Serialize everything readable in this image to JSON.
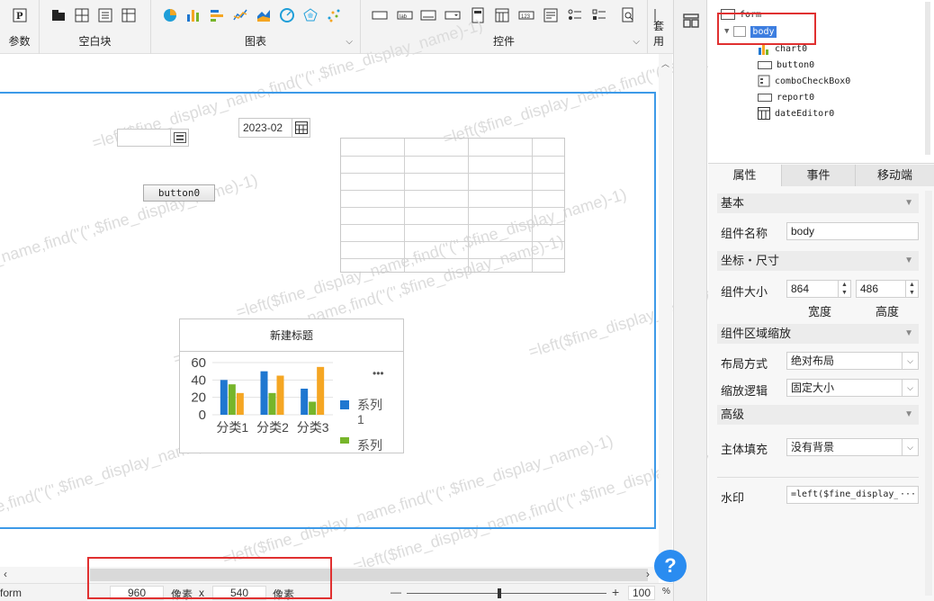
{
  "toolbar": {
    "groups": [
      {
        "label": "参数"
      },
      {
        "label": "空白块"
      },
      {
        "label": "图表"
      },
      {
        "label": "控件"
      },
      {
        "label": "套用"
      }
    ]
  },
  "canvas": {
    "watermark_text": "=left($fine_display_name,find(\"(\",$fine_display_name)-1)",
    "date_editor_value": "2023-02",
    "button_label": "button0",
    "chart": {
      "title": "新建标题",
      "more": "•••"
    }
  },
  "chart_data": {
    "type": "bar",
    "categories": [
      "分类1",
      "分类2",
      "分类3"
    ],
    "series": [
      {
        "name": "系列1",
        "values": [
          40,
          50,
          30
        ],
        "color": "#1f77d0"
      },
      {
        "name": "系列2",
        "values": [
          35,
          25,
          15
        ],
        "color": "#77b52a"
      },
      {
        "name": "",
        "values": [
          25,
          45,
          55
        ],
        "color": "#f5a623"
      }
    ],
    "yticks": [
      0,
      20,
      40,
      60
    ],
    "ylim": [
      0,
      60
    ],
    "legend_visible": [
      "系列",
      "1",
      "系列"
    ],
    "legend_position": "right"
  },
  "statusbar": {
    "form_label": "form",
    "width_value": "960",
    "unit1": "像素",
    "times": "x",
    "height_value": "540",
    "unit2": "像素",
    "zoom_minus": "—",
    "zoom_plus": "+",
    "zoom_value": "100",
    "zoom_unit": "%"
  },
  "tree": {
    "items": [
      "form",
      "body",
      "chart0",
      "button0",
      "comboCheckBox0",
      "report0",
      "dateEditor0"
    ]
  },
  "tabs": [
    "属性",
    "事件",
    "移动端"
  ],
  "properties": {
    "section_basic": "基本",
    "name_label": "组件名称",
    "name_value": "body",
    "section_coord": "坐标・尺寸",
    "size_label": "组件大小",
    "width": "864",
    "height": "486",
    "width_caption": "宽度",
    "height_caption": "高度",
    "section_zoom": "组件区域缩放",
    "layout_label": "布局方式",
    "layout_value": "绝对布局",
    "zoom_logic_label": "缩放逻辑",
    "zoom_logic_value": "固定大小",
    "section_advanced": "高级",
    "fill_label": "主体填充",
    "fill_value": "没有背景",
    "watermark_label": "水印",
    "watermark_value": "=left($fine_display_n",
    "watermark_more": "···"
  },
  "help_icon": "?"
}
